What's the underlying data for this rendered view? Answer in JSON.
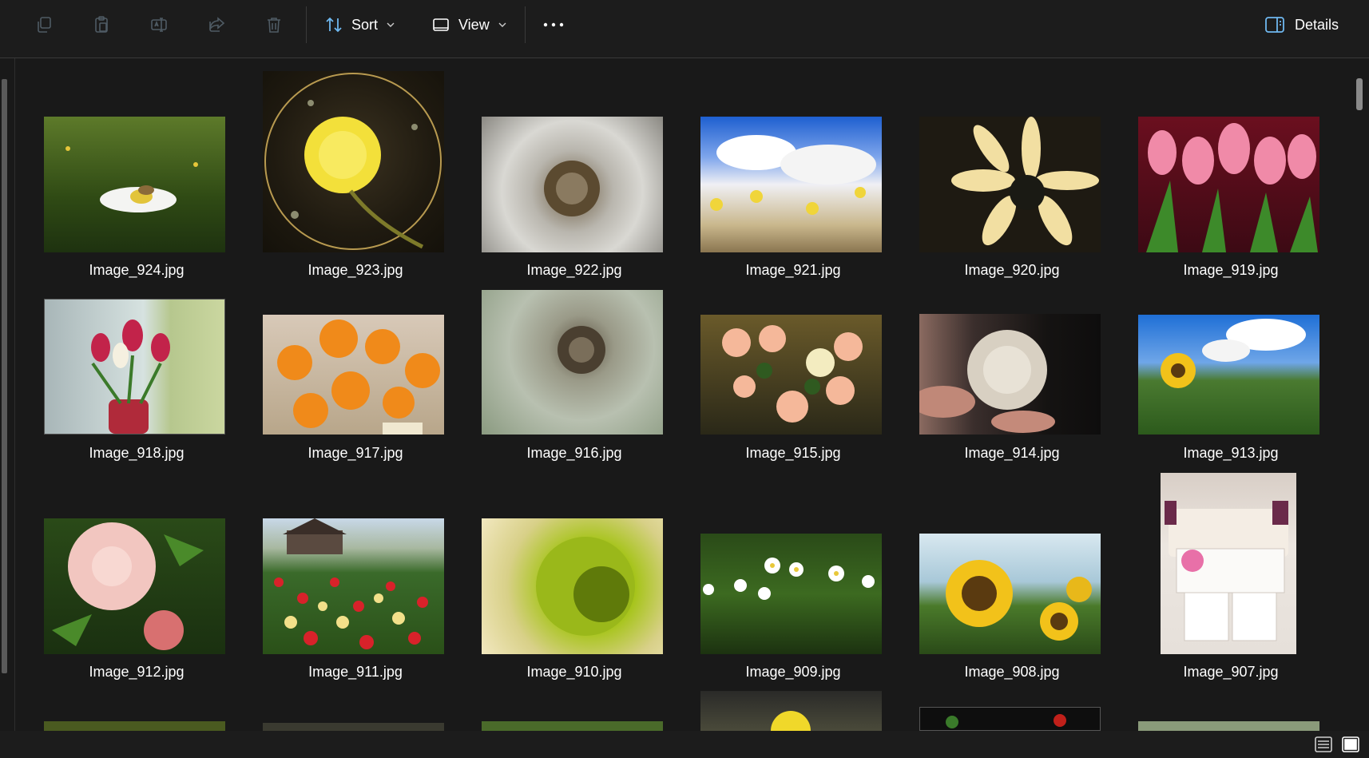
{
  "toolbar": {
    "copy_icon": "copy-icon",
    "paste_icon": "paste-icon",
    "rename_icon": "rename-icon",
    "share_icon": "share-icon",
    "delete_icon": "delete-icon",
    "sort_label": "Sort",
    "view_label": "View",
    "more_icon": "more-icon",
    "details_label": "Details"
  },
  "files": [
    {
      "name": "Image_924.jpg"
    },
    {
      "name": "Image_923.jpg"
    },
    {
      "name": "Image_922.jpg"
    },
    {
      "name": "Image_921.jpg"
    },
    {
      "name": "Image_920.jpg"
    },
    {
      "name": "Image_919.jpg"
    },
    {
      "name": "Image_918.jpg"
    },
    {
      "name": "Image_917.jpg"
    },
    {
      "name": "Image_916.jpg"
    },
    {
      "name": "Image_915.jpg"
    },
    {
      "name": "Image_914.jpg"
    },
    {
      "name": "Image_913.jpg"
    },
    {
      "name": "Image_912.jpg"
    },
    {
      "name": "Image_911.jpg"
    },
    {
      "name": "Image_910.jpg"
    },
    {
      "name": "Image_909.jpg"
    },
    {
      "name": "Image_908.jpg"
    },
    {
      "name": "Image_907.jpg"
    }
  ],
  "colors": {
    "background": "#191919",
    "toolbar": "#1c1c1c",
    "text": "#ffffff",
    "icon_disabled": "#4a5a66",
    "accent": "#6fb8f0"
  }
}
